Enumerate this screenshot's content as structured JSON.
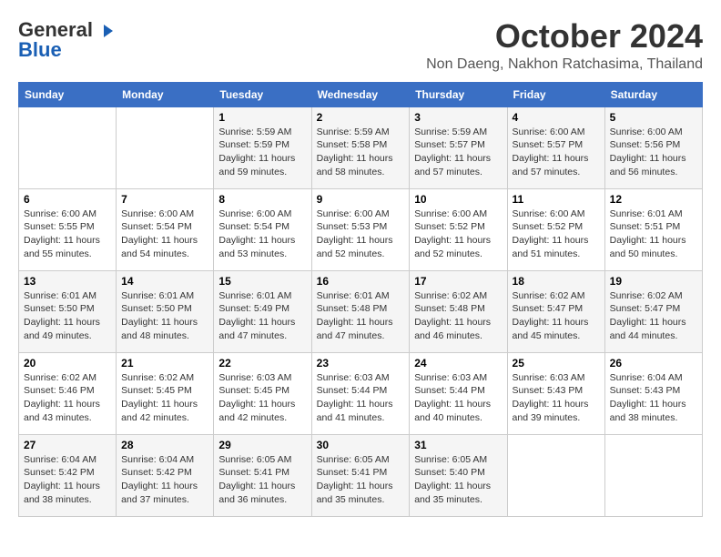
{
  "logo": {
    "line1": "General",
    "line2": "Blue"
  },
  "title": "October 2024",
  "location": "Non Daeng, Nakhon Ratchasima, Thailand",
  "weekdays": [
    "Sunday",
    "Monday",
    "Tuesday",
    "Wednesday",
    "Thursday",
    "Friday",
    "Saturday"
  ],
  "weeks": [
    [
      {
        "day": "",
        "info": ""
      },
      {
        "day": "",
        "info": ""
      },
      {
        "day": "1",
        "info": "Sunrise: 5:59 AM\nSunset: 5:59 PM\nDaylight: 11 hours and 59 minutes."
      },
      {
        "day": "2",
        "info": "Sunrise: 5:59 AM\nSunset: 5:58 PM\nDaylight: 11 hours and 58 minutes."
      },
      {
        "day": "3",
        "info": "Sunrise: 5:59 AM\nSunset: 5:57 PM\nDaylight: 11 hours and 57 minutes."
      },
      {
        "day": "4",
        "info": "Sunrise: 6:00 AM\nSunset: 5:57 PM\nDaylight: 11 hours and 57 minutes."
      },
      {
        "day": "5",
        "info": "Sunrise: 6:00 AM\nSunset: 5:56 PM\nDaylight: 11 hours and 56 minutes."
      }
    ],
    [
      {
        "day": "6",
        "info": "Sunrise: 6:00 AM\nSunset: 5:55 PM\nDaylight: 11 hours and 55 minutes."
      },
      {
        "day": "7",
        "info": "Sunrise: 6:00 AM\nSunset: 5:54 PM\nDaylight: 11 hours and 54 minutes."
      },
      {
        "day": "8",
        "info": "Sunrise: 6:00 AM\nSunset: 5:54 PM\nDaylight: 11 hours and 53 minutes."
      },
      {
        "day": "9",
        "info": "Sunrise: 6:00 AM\nSunset: 5:53 PM\nDaylight: 11 hours and 52 minutes."
      },
      {
        "day": "10",
        "info": "Sunrise: 6:00 AM\nSunset: 5:52 PM\nDaylight: 11 hours and 52 minutes."
      },
      {
        "day": "11",
        "info": "Sunrise: 6:00 AM\nSunset: 5:52 PM\nDaylight: 11 hours and 51 minutes."
      },
      {
        "day": "12",
        "info": "Sunrise: 6:01 AM\nSunset: 5:51 PM\nDaylight: 11 hours and 50 minutes."
      }
    ],
    [
      {
        "day": "13",
        "info": "Sunrise: 6:01 AM\nSunset: 5:50 PM\nDaylight: 11 hours and 49 minutes."
      },
      {
        "day": "14",
        "info": "Sunrise: 6:01 AM\nSunset: 5:50 PM\nDaylight: 11 hours and 48 minutes."
      },
      {
        "day": "15",
        "info": "Sunrise: 6:01 AM\nSunset: 5:49 PM\nDaylight: 11 hours and 47 minutes."
      },
      {
        "day": "16",
        "info": "Sunrise: 6:01 AM\nSunset: 5:48 PM\nDaylight: 11 hours and 47 minutes."
      },
      {
        "day": "17",
        "info": "Sunrise: 6:02 AM\nSunset: 5:48 PM\nDaylight: 11 hours and 46 minutes."
      },
      {
        "day": "18",
        "info": "Sunrise: 6:02 AM\nSunset: 5:47 PM\nDaylight: 11 hours and 45 minutes."
      },
      {
        "day": "19",
        "info": "Sunrise: 6:02 AM\nSunset: 5:47 PM\nDaylight: 11 hours and 44 minutes."
      }
    ],
    [
      {
        "day": "20",
        "info": "Sunrise: 6:02 AM\nSunset: 5:46 PM\nDaylight: 11 hours and 43 minutes."
      },
      {
        "day": "21",
        "info": "Sunrise: 6:02 AM\nSunset: 5:45 PM\nDaylight: 11 hours and 42 minutes."
      },
      {
        "day": "22",
        "info": "Sunrise: 6:03 AM\nSunset: 5:45 PM\nDaylight: 11 hours and 42 minutes."
      },
      {
        "day": "23",
        "info": "Sunrise: 6:03 AM\nSunset: 5:44 PM\nDaylight: 11 hours and 41 minutes."
      },
      {
        "day": "24",
        "info": "Sunrise: 6:03 AM\nSunset: 5:44 PM\nDaylight: 11 hours and 40 minutes."
      },
      {
        "day": "25",
        "info": "Sunrise: 6:03 AM\nSunset: 5:43 PM\nDaylight: 11 hours and 39 minutes."
      },
      {
        "day": "26",
        "info": "Sunrise: 6:04 AM\nSunset: 5:43 PM\nDaylight: 11 hours and 38 minutes."
      }
    ],
    [
      {
        "day": "27",
        "info": "Sunrise: 6:04 AM\nSunset: 5:42 PM\nDaylight: 11 hours and 38 minutes."
      },
      {
        "day": "28",
        "info": "Sunrise: 6:04 AM\nSunset: 5:42 PM\nDaylight: 11 hours and 37 minutes."
      },
      {
        "day": "29",
        "info": "Sunrise: 6:05 AM\nSunset: 5:41 PM\nDaylight: 11 hours and 36 minutes."
      },
      {
        "day": "30",
        "info": "Sunrise: 6:05 AM\nSunset: 5:41 PM\nDaylight: 11 hours and 35 minutes."
      },
      {
        "day": "31",
        "info": "Sunrise: 6:05 AM\nSunset: 5:40 PM\nDaylight: 11 hours and 35 minutes."
      },
      {
        "day": "",
        "info": ""
      },
      {
        "day": "",
        "info": ""
      }
    ]
  ]
}
